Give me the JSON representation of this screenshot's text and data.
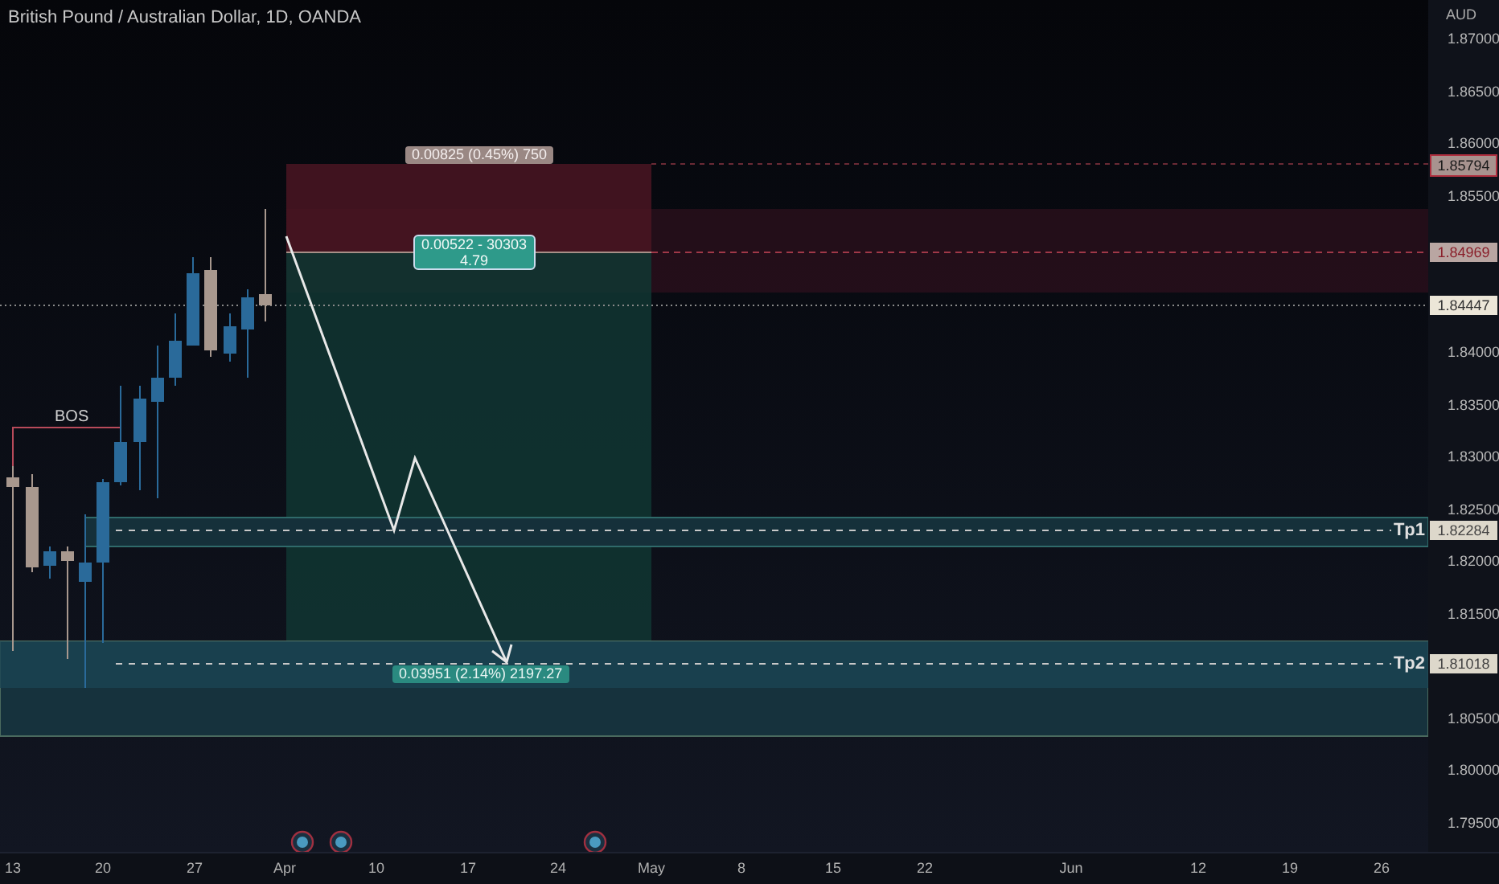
{
  "title": "British Pound / Australian Dollar, 1D, OANDA",
  "currency": "AUD",
  "price_ticks": [
    "1.87000",
    "1.86500",
    "1.86000",
    "1.85500",
    "1.84000",
    "1.83500",
    "1.83000",
    "1.82500",
    "1.82000",
    "1.81500",
    "1.80500",
    "1.80000",
    "1.79500"
  ],
  "price_labels": [
    {
      "kind": "stop",
      "text": "1.85794"
    },
    {
      "kind": "entry",
      "text": "1.84969"
    },
    {
      "kind": "last",
      "text": "1.84447"
    },
    {
      "kind": "tp1",
      "text": "1.82284"
    },
    {
      "kind": "tp2",
      "text": "1.81018"
    }
  ],
  "bos_label": "BOS",
  "take_profits": [
    {
      "label": "Tp1"
    },
    {
      "label": "Tp2"
    }
  ],
  "position": {
    "stop_label": "0.00825 (0.45%) 750",
    "entry_lines": [
      "0.00522 - 30303",
      "4.79"
    ],
    "target_label": "0.03951 (2.14%) 2197.27"
  },
  "time_labels": [
    "13",
    "20",
    "27",
    "Apr",
    "10",
    "17",
    "24",
    "May",
    "8",
    "15",
    "22",
    "Jun",
    "12",
    "19",
    "26"
  ]
}
